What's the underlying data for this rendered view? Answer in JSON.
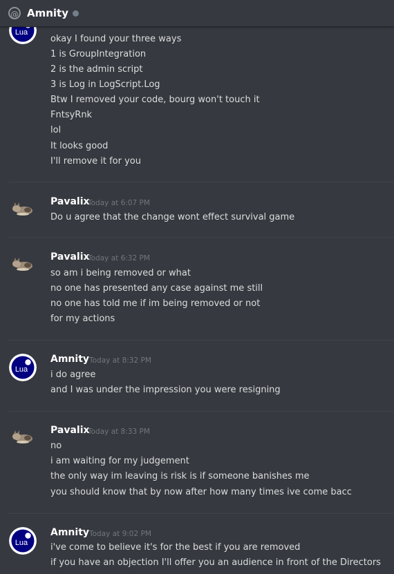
{
  "header": {
    "title": "Amnity",
    "icon": "at-icon",
    "status": "offline"
  },
  "groups": [
    {
      "author": "",
      "time": "",
      "avatar": "lua-logo",
      "avatar_text": "Lua",
      "lines": [
        "okay I found your three ways",
        "1 is GroupIntegration",
        "2 is the admin script",
        "3 is Log in LogScript.Log",
        "Btw I removed your code, bourg won't touch it",
        "FntsyRnk",
        "lol",
        "It looks good",
        "I'll remove it for you"
      ]
    },
    {
      "author": "Pavalix",
      "time": "Today at 6:07 PM",
      "avatar": "cat",
      "lines": [
        "Do u agree that the change wont effect survival game"
      ]
    },
    {
      "author": "Pavalix",
      "time": "Today at 6:32 PM",
      "avatar": "cat",
      "lines": [
        "so am i being removed or what",
        "no one has presented any case against me still",
        "no one has told me if im being removed or not",
        "for my actions"
      ]
    },
    {
      "author": "Amnity",
      "time": "Today at 8:32 PM",
      "avatar": "lua-logo",
      "avatar_text": "Lua",
      "lines": [
        "i do agree",
        "and I was under the impression you were resigning"
      ]
    },
    {
      "author": "Pavalix",
      "time": "Today at 8:33 PM",
      "avatar": "cat",
      "lines": [
        "no",
        "i am waiting for my judgement",
        "the only way im leaving is risk is if someone banishes me",
        "you should know that by now after how many times ive come bacc"
      ]
    },
    {
      "author": "Amnity",
      "time": "Today at 9:02 PM",
      "avatar": "lua-logo",
      "avatar_text": "Lua",
      "lines": [
        "i've come to believe it's for the best if you are removed",
        "if you have an objection I'll offer you an audience in front of the Directors"
      ]
    }
  ]
}
